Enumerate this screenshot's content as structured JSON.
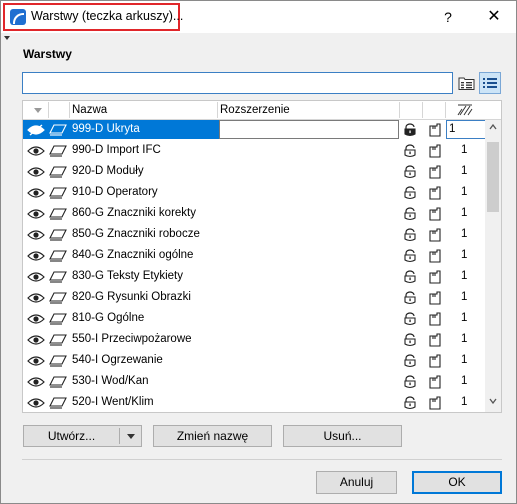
{
  "window": {
    "title": "Warstwy (teczka arkuszy)...",
    "help_label": "?",
    "close_label": "✕"
  },
  "section": {
    "label": "Warstwy"
  },
  "search": {
    "value": "",
    "placeholder": ""
  },
  "table": {
    "headers": {
      "name": "Nazwa",
      "extension": "Rozszerzenie"
    },
    "rows": [
      {
        "name": "999-D Ukryta",
        "count": "1",
        "selected": true
      },
      {
        "name": "990-D Import IFC",
        "count": "1"
      },
      {
        "name": "920-D Moduły",
        "count": "1"
      },
      {
        "name": "910-D Operatory",
        "count": "1"
      },
      {
        "name": "860-G Znaczniki korekty",
        "count": "1"
      },
      {
        "name": "850-G Znaczniki robocze",
        "count": "1"
      },
      {
        "name": "840-G Znaczniki ogólne",
        "count": "1"
      },
      {
        "name": "830-G Teksty Etykiety",
        "count": "1"
      },
      {
        "name": "820-G Rysunki Obrazki",
        "count": "1"
      },
      {
        "name": "810-G Ogólne",
        "count": "1"
      },
      {
        "name": "550-I Przeciwpożarowe",
        "count": "1"
      },
      {
        "name": "540-I Ogrzewanie",
        "count": "1"
      },
      {
        "name": "530-I Wod/Kan",
        "count": "1"
      },
      {
        "name": "520-I Went/Klim",
        "count": "1"
      }
    ]
  },
  "buttons": {
    "create": "Utwórz...",
    "rename": "Zmień nazwę",
    "delete": "Usuń...",
    "cancel": "Anuluj",
    "ok": "OK"
  },
  "colors": {
    "accent": "#0078d7",
    "highlight_border": "#e0262a"
  }
}
